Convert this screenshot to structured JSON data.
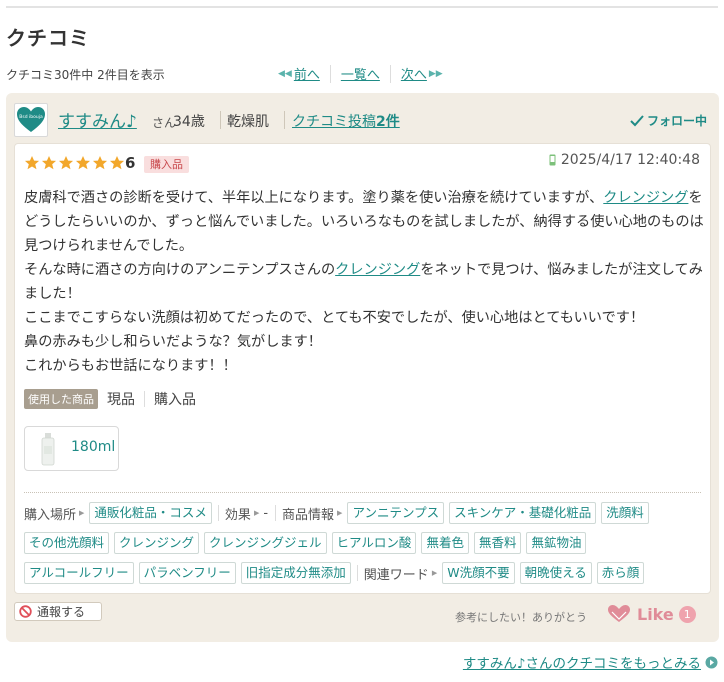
{
  "page": {
    "title": "クチコミ"
  },
  "pager": {
    "count_text": "クチコミ30件中 2件目を表示",
    "prev": "前へ",
    "list": "一覧へ",
    "next": "次へ"
  },
  "user": {
    "avatar_text": "Bsd ibouja",
    "name": "すすみん♪",
    "suffix": "さん",
    "age": "34歳",
    "skin": "乾燥肌",
    "posts_prefix": "クチコミ投稿",
    "posts_count": "2件",
    "follow": "フォロー中"
  },
  "review": {
    "rating": "6",
    "star_count": 6,
    "purchase_badge": "購入品",
    "datetime": "2025/4/17 12:40:48",
    "p1_a": "皮膚科で酒さの診断を受けて、半年以上になります。塗り薬を使い治療を続けていますが、",
    "p1_link": "クレンジング",
    "p1_b": "をどうしたらいいのか、ずっと悩んでいました。いろいろなものを試しましたが、納得する使い心地のものは見つけられませんでした。",
    "p2_a": "そんな時に酒さの方向けのアンニテンプスさんの",
    "p2_link": "クレンジング",
    "p2_b": "をネットで見つけ、悩みましたが注文してみました！",
    "p3": "ここまでこすらない洗顔は初めてだったので、とても不安でしたが、使い心地はとてもいいです！",
    "p4": "鼻の赤みも少し和らいだような？気がします！",
    "p5": "これからもお世話になります！！"
  },
  "product": {
    "used_label": "使用した商品",
    "tag1": "現品",
    "tag2": "購入品",
    "size": "180ml"
  },
  "tags": {
    "place_label": "購入場所",
    "place": [
      "通販化粧品・コスメ"
    ],
    "effect_label": "効果",
    "effect_value": "-",
    "info_label": "商品情報",
    "info_line1": [
      "アンニテンプス",
      "スキンケア・基礎化粧品",
      "洗顔料"
    ],
    "info_line2": [
      "その他洗顔料",
      "クレンジング",
      "クレンジングジェル",
      "ヒアルロン酸",
      "無着色",
      "無香料",
      "無鉱物油"
    ],
    "info_line3": [
      "アルコールフリー",
      "パラベンフリー",
      "旧指定成分無添加"
    ],
    "related_label": "関連ワード",
    "related": [
      "W洗顔不要",
      "朝晩使える",
      "赤ら顔"
    ]
  },
  "footer": {
    "report": "通報する",
    "helpful": "参考にしたい！ありがとう",
    "like": "Like",
    "like_count": "1",
    "more_link": "すすみん♪さんのクチコミをもっとみる"
  },
  "colors": {
    "accent": "#1f8b86",
    "card_bg": "#f2ede4",
    "star": "#f2a72b",
    "like": "#e08c98"
  }
}
